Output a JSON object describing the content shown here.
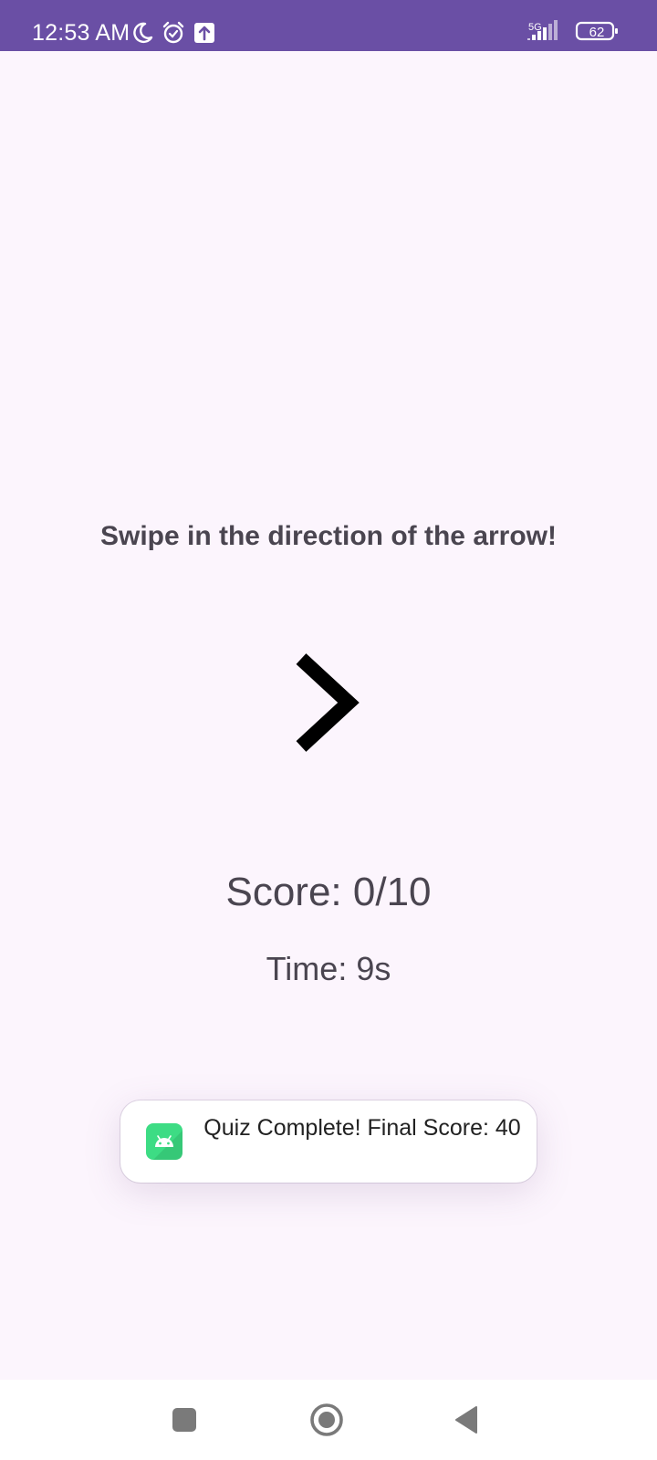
{
  "status_bar": {
    "time": "12:53 AM",
    "icons": [
      "moon-icon",
      "alarm-icon",
      "upload-icon"
    ],
    "network": "5G",
    "battery_level": "62",
    "background_color": "#6a4fa5"
  },
  "game": {
    "instruction": "Swipe in the direction of the arrow!",
    "arrow_direction": "right",
    "score": "Score: 0/10",
    "time": "Time: 9s"
  },
  "toast": {
    "message": "Quiz Complete! Final Score: 40",
    "app_icon": "android-icon"
  },
  "nav_bar": {
    "buttons": [
      "recents-button",
      "home-button",
      "back-button"
    ]
  }
}
